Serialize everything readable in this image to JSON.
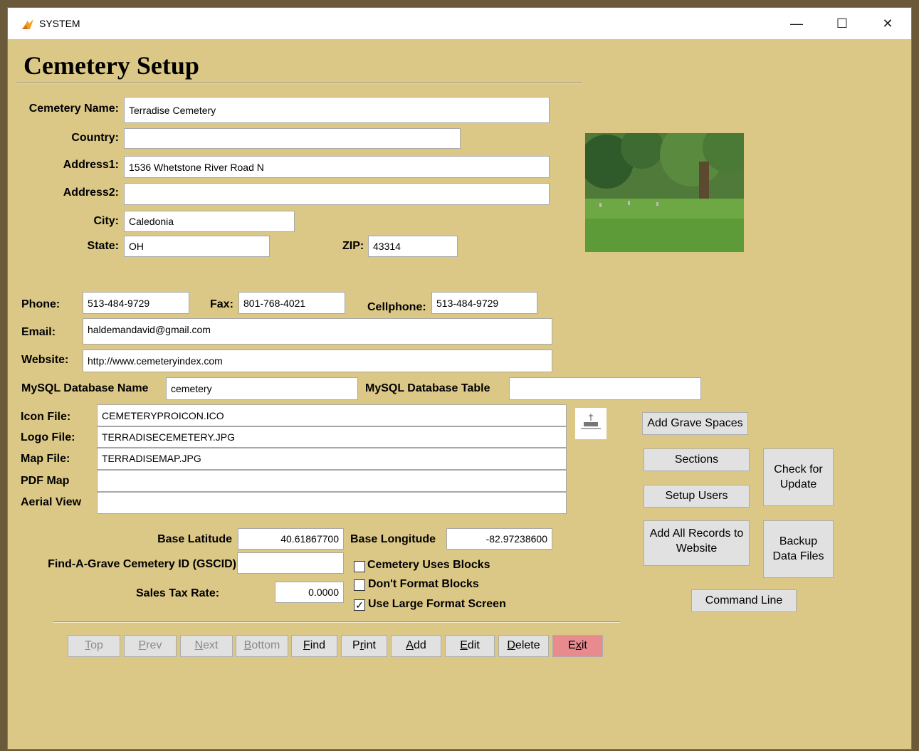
{
  "window": {
    "title": "SYSTEM",
    "minimize": "—",
    "maximize": "☐",
    "close": "✕"
  },
  "page": {
    "heading": "Cemetery Setup"
  },
  "form": {
    "cemetery_name": {
      "label": "Cemetery Name:",
      "value": "Terradise Cemetery"
    },
    "country": {
      "label": "Country:",
      "value": ""
    },
    "address1": {
      "label": "Address1:",
      "value": "1536 Whetstone River Road N"
    },
    "address2": {
      "label": "Address2:",
      "value": ""
    },
    "city": {
      "label": "City:",
      "value": "Caledonia"
    },
    "state": {
      "label": "State:",
      "value": "OH"
    },
    "zip": {
      "label": "ZIP:",
      "value": "43314"
    },
    "phone": {
      "label": "Phone:",
      "value": "513-484-9729"
    },
    "fax": {
      "label": "Fax:",
      "value": "801-768-4021"
    },
    "cellphone": {
      "label": "Cellphone:",
      "value": "513-484-9729"
    },
    "email": {
      "label": "Email:",
      "value": "haldemandavid@gmail.com"
    },
    "website": {
      "label": "Website:",
      "value": "http://www.cemeteryindex.com"
    },
    "mysql_db_name": {
      "label": "MySQL Database Name",
      "value": "cemetery"
    },
    "mysql_db_table": {
      "label": "MySQL Database Table",
      "value": ""
    },
    "icon_file": {
      "label": "Icon File:",
      "value": "CEMETERYPROICON.ICO"
    },
    "logo_file": {
      "label": "Logo File:",
      "value": "TERRADISECEMETERY.JPG"
    },
    "map_file": {
      "label": "Map File:",
      "value": "TERRADISEMAP.JPG"
    },
    "pdf_map": {
      "label": "PDF Map",
      "value": ""
    },
    "aerial_view": {
      "label": "Aerial View",
      "value": ""
    },
    "base_latitude": {
      "label": "Base Latitude",
      "value": "40.61867700"
    },
    "base_longitude": {
      "label": "Base Longitude",
      "value": "-82.97238600"
    },
    "gscid": {
      "label": "Find-A-Grave Cemetery ID (GSCID)",
      "value": ""
    },
    "sales_tax": {
      "label": "Sales Tax Rate:",
      "value": "0.0000"
    }
  },
  "checkboxes": {
    "uses_blocks": {
      "label": "Cemetery Uses Blocks",
      "checked": false,
      "mark": ""
    },
    "dont_format": {
      "label": "Don't Format Blocks",
      "checked": false,
      "mark": ""
    },
    "large_format": {
      "label": "Use Large Format Screen",
      "checked": true,
      "mark": "✓"
    }
  },
  "side_buttons": {
    "add_grave_spaces": "Add Grave Spaces",
    "sections": "Sections",
    "check_update_1": "Check for",
    "check_update_2": "Update",
    "setup_users": "Setup Users",
    "add_all_1": "Add All Records to",
    "add_all_2": "Website",
    "backup_1": "Backup",
    "backup_2": "Data Files",
    "command_line": "Command Line"
  },
  "nav": {
    "top": {
      "key": "T",
      "rest": "op"
    },
    "prev": {
      "key": "P",
      "rest": "rev"
    },
    "next": {
      "key": "N",
      "rest": "ext"
    },
    "bottom": {
      "key": "B",
      "rest": "ottom"
    },
    "find": {
      "key": "F",
      "rest": "ind"
    },
    "print": {
      "pre": "P",
      "key": "r",
      "rest": "int"
    },
    "add": {
      "key": "A",
      "rest": "dd"
    },
    "edit": {
      "key": "E",
      "rest": "dit"
    },
    "delete": {
      "key": "D",
      "rest": "elete"
    },
    "exit": {
      "pre": "E",
      "key": "x",
      "rest": "it"
    }
  },
  "colors": {
    "background": "#dcc886",
    "exit_button": "#e98a8f",
    "button": "#e1e1e1"
  }
}
